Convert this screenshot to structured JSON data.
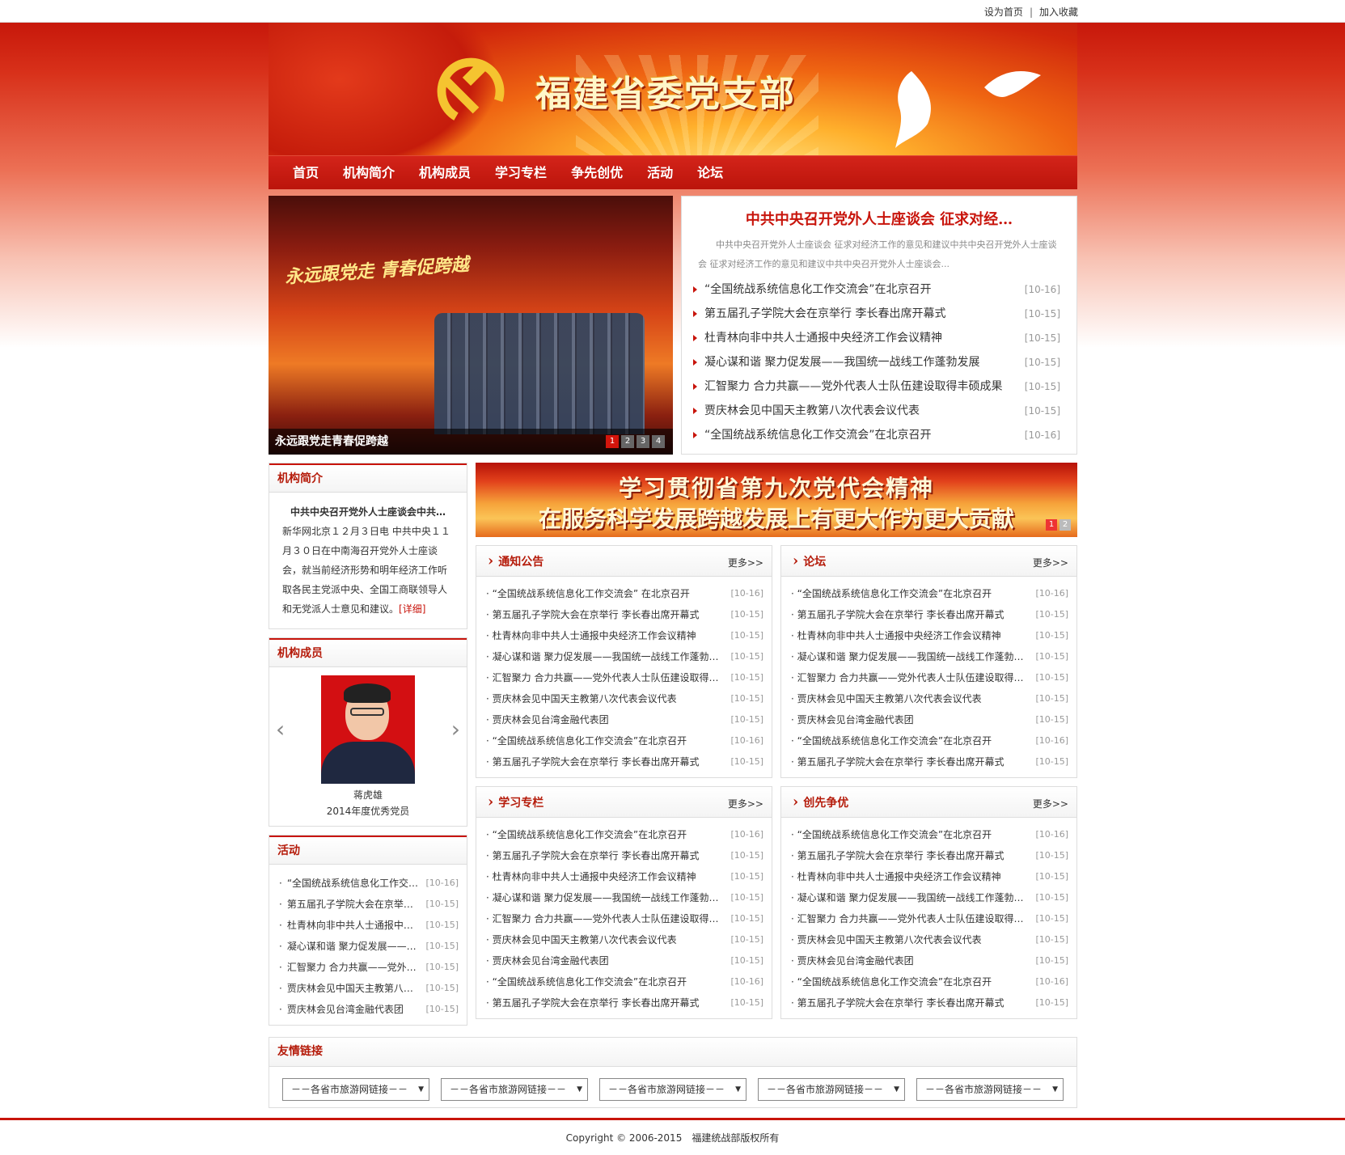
{
  "toplinks": {
    "home": "设为首页",
    "sep": "|",
    "fav": "加入收藏"
  },
  "header": {
    "title": "福建省委党支部"
  },
  "nav": [
    "首页",
    "机构简介",
    "机构成员",
    "学习专栏",
    "争先创优",
    "活动",
    "论坛"
  ],
  "slider": {
    "caption": "永远跟党走青春促跨越",
    "stage_text": "永远跟党走  青春促跨越",
    "dots": [
      "1",
      "2",
      "3",
      "4"
    ],
    "active": 0
  },
  "headline": {
    "title": "中共中央召开党外人士座谈会 征求对经…",
    "desc": "中共中央召开党外人士座谈会 征求对经济工作的意见和建议中共中央召开党外人士座谈会 征求对经济工作的意见和建议中共中央召开党外人士座谈会...",
    "items": [
      {
        "t": "“全国统战系统信息化工作交流会”在北京召开",
        "d": "[10-16]"
      },
      {
        "t": "第五届孔子学院大会在京举行 李长春出席开幕式",
        "d": "[10-15]"
      },
      {
        "t": "杜青林向非中共人士通报中央经济工作会议精神",
        "d": "[10-15]"
      },
      {
        "t": "凝心谋和谐 聚力促发展——我国统一战线工作蓬勃发展",
        "d": "[10-15]"
      },
      {
        "t": "汇智聚力 合力共赢——党外代表人士队伍建设取得丰硕成果",
        "d": "[10-15]"
      },
      {
        "t": "贾庆林会见中国天主教第八次代表会议代表",
        "d": "[10-15]"
      },
      {
        "t": "“全国统战系统信息化工作交流会”在北京召开",
        "d": "[10-16]"
      }
    ]
  },
  "intro": {
    "title": "机构简介",
    "bold": "中共中央召开党外人士座谈会中共…",
    "text": "新华网北京１２月３日电 中共中央１１月３０日在中南海召开党外人士座谈会，就当前经济形势和明年经济工作听取各民主党派中央、全国工商联领导人和无党派人士意见和建议。",
    "more": "[详细]"
  },
  "members": {
    "title": "机构成员",
    "name": "蒋虎雄",
    "note": "2014年度优秀党员"
  },
  "activity": {
    "title": "活动",
    "items": [
      {
        "t": "“全国统战系统信息化工作交…",
        "d": "[10-16]"
      },
      {
        "t": "第五届孔子学院大会在京举…",
        "d": "[10-15]"
      },
      {
        "t": "杜青林向非中共人士通报中…",
        "d": "[10-15]"
      },
      {
        "t": "凝心谋和谐 聚力促发展——…",
        "d": "[10-15]"
      },
      {
        "t": "汇智聚力 合力共赢——党外…",
        "d": "[10-15]"
      },
      {
        "t": "贾庆林会见中国天主教第八…",
        "d": "[10-15]"
      },
      {
        "t": "贾庆林会见台湾金融代表团",
        "d": "[10-15]"
      }
    ]
  },
  "ad": {
    "line1": "学习贯彻省第九次党代会精神",
    "line2": "在服务科学发展跨越发展上有更大作为更大贡献",
    "dots": [
      "1",
      "2"
    ]
  },
  "more_label": "更多>>",
  "sections": [
    {
      "title": "通知公告",
      "items": [
        {
          "t": "“全国统战系统信息化工作交流会” 在北京召开",
          "d": "[10-16]"
        },
        {
          "t": "第五届孔子学院大会在京举行 李长春出席开幕式",
          "d": "[10-15]"
        },
        {
          "t": "杜青林向非中共人士通报中央经济工作会议精神",
          "d": "[10-15]"
        },
        {
          "t": "凝心谋和谐 聚力促发展——我国统一战线工作蓬勃…",
          "d": "[10-15]"
        },
        {
          "t": "汇智聚力 合力共赢——党外代表人士队伍建设取得…",
          "d": "[10-15]"
        },
        {
          "t": "贾庆林会见中国天主教第八次代表会议代表",
          "d": "[10-15]"
        },
        {
          "t": "贾庆林会见台湾金融代表团",
          "d": "[10-15]"
        },
        {
          "t": "“全国统战系统信息化工作交流会”在北京召开",
          "d": "[10-16]"
        },
        {
          "t": "第五届孔子学院大会在京举行 李长春出席开幕式",
          "d": "[10-15]"
        }
      ]
    },
    {
      "title": "论坛",
      "items": [
        {
          "t": "“全国统战系统信息化工作交流会”在北京召开",
          "d": "[10-16]"
        },
        {
          "t": "第五届孔子学院大会在京举行 李长春出席开幕式",
          "d": "[10-15]"
        },
        {
          "t": "杜青林向非中共人士通报中央经济工作会议精神",
          "d": "[10-15]"
        },
        {
          "t": "凝心谋和谐 聚力促发展——我国统一战线工作蓬勃…",
          "d": "[10-15]"
        },
        {
          "t": "汇智聚力 合力共赢——党外代表人士队伍建设取得…",
          "d": "[10-15]"
        },
        {
          "t": "贾庆林会见中国天主教第八次代表会议代表",
          "d": "[10-15]"
        },
        {
          "t": "贾庆林会见台湾金融代表团",
          "d": "[10-15]"
        },
        {
          "t": "“全国统战系统信息化工作交流会”在北京召开",
          "d": "[10-16]"
        },
        {
          "t": "第五届孔子学院大会在京举行 李长春出席开幕式",
          "d": "[10-15]"
        }
      ]
    },
    {
      "title": "学习专栏",
      "items": [
        {
          "t": "“全国统战系统信息化工作交流会”在北京召开",
          "d": "[10-16]"
        },
        {
          "t": "第五届孔子学院大会在京举行 李长春出席开幕式",
          "d": "[10-15]"
        },
        {
          "t": "杜青林向非中共人士通报中央经济工作会议精神",
          "d": "[10-15]"
        },
        {
          "t": "凝心谋和谐 聚力促发展——我国统一战线工作蓬勃…",
          "d": "[10-15]"
        },
        {
          "t": "汇智聚力 合力共赢——党外代表人士队伍建设取得…",
          "d": "[10-15]"
        },
        {
          "t": "贾庆林会见中国天主教第八次代表会议代表",
          "d": "[10-15]"
        },
        {
          "t": "贾庆林会见台湾金融代表团",
          "d": "[10-15]"
        },
        {
          "t": "“全国统战系统信息化工作交流会”在北京召开",
          "d": "[10-16]"
        },
        {
          "t": "第五届孔子学院大会在京举行 李长春出席开幕式",
          "d": "[10-15]"
        }
      ]
    },
    {
      "title": "创先争优",
      "items": [
        {
          "t": "“全国统战系统信息化工作交流会”在北京召开",
          "d": "[10-16]"
        },
        {
          "t": "第五届孔子学院大会在京举行 李长春出席开幕式",
          "d": "[10-15]"
        },
        {
          "t": "杜青林向非中共人士通报中央经济工作会议精神",
          "d": "[10-15]"
        },
        {
          "t": "凝心谋和谐 聚力促发展——我国统一战线工作蓬勃…",
          "d": "[10-15]"
        },
        {
          "t": "汇智聚力 合力共赢——党外代表人士队伍建设取得…",
          "d": "[10-15]"
        },
        {
          "t": "贾庆林会见中国天主教第八次代表会议代表",
          "d": "[10-15]"
        },
        {
          "t": "贾庆林会见台湾金融代表团",
          "d": "[10-15]"
        },
        {
          "t": "“全国统战系统信息化工作交流会”在北京召开",
          "d": "[10-16]"
        },
        {
          "t": "第五届孔子学院大会在京举行 李长春出席开幕式",
          "d": "[10-15]"
        }
      ]
    }
  ],
  "links": {
    "title": "友情链接",
    "option": "－－各省市旅游网链接－－",
    "count": 5
  },
  "footer": {
    "copyright": "Copyright © 2006-2015",
    "owner": "福建统战部版权所有"
  },
  "colors": {
    "accent": "#c8140b",
    "nav": "#c81a10"
  }
}
